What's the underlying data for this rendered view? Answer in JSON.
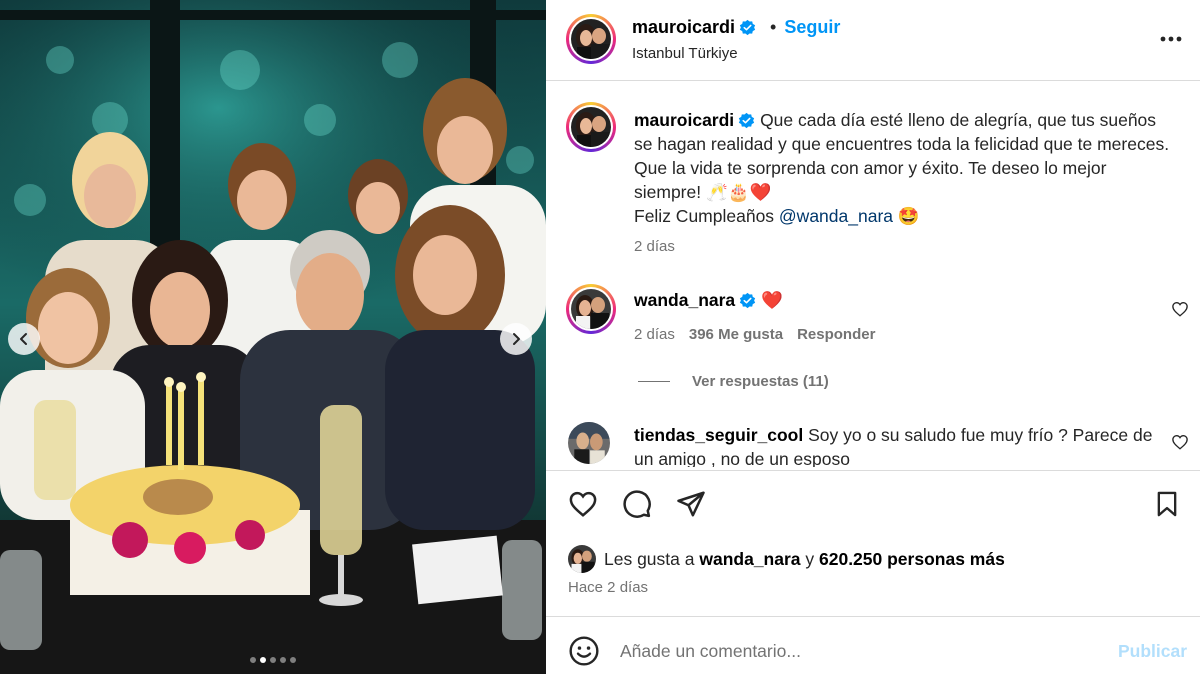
{
  "post": {
    "author": "mauroicardi",
    "separator": "•",
    "follow_label": "Seguir",
    "location": "Istanbul Türkiye",
    "media_dots": 5,
    "media_active_dot": 1
  },
  "caption": {
    "user": "mauroicardi",
    "text": "Que cada día esté lleno de alegría, que tus sueños se hagan realidad y que encuentres toda la felicidad que te mereces. Que la vida te sorprenda con amor y éxito. Te deseo lo mejor siempre! 🥂🎂❤️",
    "line2_prefix": "Feliz Cumpleaños ",
    "mention": "@wanda_nara",
    "line2_emoji": " 🤩",
    "time": "2 días"
  },
  "comments": [
    {
      "user": "wanda_nara",
      "text": " ❤️",
      "time": "2 días",
      "likes": "396 Me gusta",
      "reply_label": "Responder",
      "view_replies": "Ver respuestas (11)"
    },
    {
      "user": "tiendas_seguir_cool",
      "text": " Soy yo o su saludo fue muy frío ? Parece de un amigo , no de un esposo"
    }
  ],
  "likes": {
    "prefix": "Les gusta a ",
    "user": "wanda_nara",
    "middle": " y ",
    "count": "620.250 personas más"
  },
  "posted_ago": "Hace 2 días",
  "add_comment": {
    "placeholder": "Añade un comentario...",
    "publish_label": "Publicar"
  },
  "colors": {
    "accent": "#0095f6",
    "publish_disabled": "#b2dffc",
    "heart": "#ed1c2e",
    "verified": "#0095f6"
  }
}
